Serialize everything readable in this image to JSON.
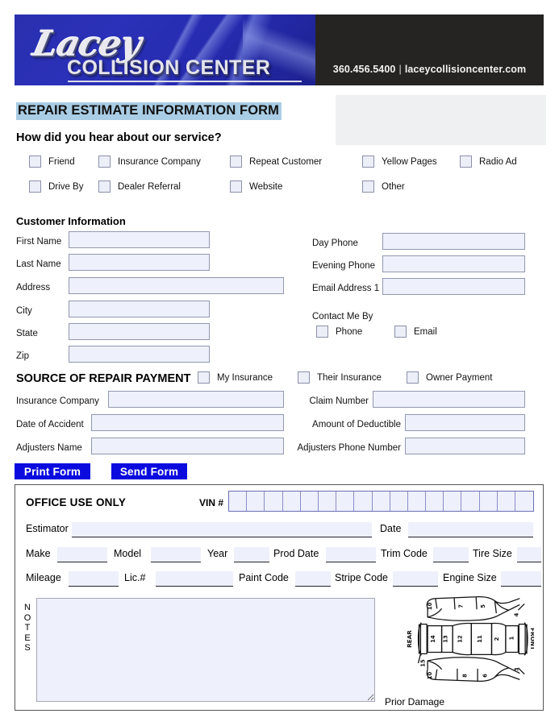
{
  "header": {
    "logo_script": "Lacey",
    "logo_main": "COLLISION CENTER",
    "phone": "360.456.5400",
    "separator": "|",
    "website": "laceycollisioncenter.com"
  },
  "form": {
    "title": "REPAIR ESTIMATE INFORMATION FORM",
    "question": "How did you hear about our service?",
    "referral_options": [
      {
        "label": "Friend"
      },
      {
        "label": "Insurance Company"
      },
      {
        "label": "Repeat Customer"
      },
      {
        "label": "Yellow Pages"
      },
      {
        "label": "Radio Ad"
      },
      {
        "label": "Drive By"
      },
      {
        "label": "Dealer Referral"
      },
      {
        "label": "Website"
      },
      {
        "label": "Other"
      }
    ]
  },
  "customer": {
    "section_title": "Customer Information",
    "left_fields": [
      {
        "label": "First Name",
        "value": ""
      },
      {
        "label": "Last Name",
        "value": ""
      },
      {
        "label": "Address",
        "value": ""
      },
      {
        "label": "City",
        "value": ""
      },
      {
        "label": "State",
        "value": ""
      },
      {
        "label": "Zip",
        "value": ""
      }
    ],
    "right_fields": [
      {
        "label": "Day Phone",
        "value": ""
      },
      {
        "label": "Evening Phone",
        "value": ""
      },
      {
        "label": "Email Address 1",
        "value": ""
      }
    ],
    "contact_me_by": "Contact Me By",
    "contact_options": [
      {
        "label": "Phone"
      },
      {
        "label": "Email"
      }
    ]
  },
  "payment": {
    "section_title": "SOURCE OF REPAIR PAYMENT",
    "options": [
      {
        "label": "My Insurance"
      },
      {
        "label": "Their Insurance"
      },
      {
        "label": "Owner Payment"
      }
    ],
    "left_fields": [
      {
        "label": "Insurance Company",
        "value": ""
      },
      {
        "label": "Date of Accident",
        "value": ""
      },
      {
        "label": "Adjusters Name",
        "value": ""
      }
    ],
    "right_fields": [
      {
        "label": "Claim Number",
        "value": ""
      },
      {
        "label": "Amount of Deductible",
        "value": ""
      },
      {
        "label": "Adjusters Phone Number",
        "value": ""
      }
    ]
  },
  "actions": {
    "print_label": "Print Form",
    "send_label": "Send Form"
  },
  "office": {
    "title": "OFFICE USE ONLY",
    "vin_label": "VIN #",
    "vin_cells": 17,
    "estimator_label": "Estimator",
    "date_label": "Date",
    "vehicle_row1": [
      {
        "label": "Make"
      },
      {
        "label": "Model"
      },
      {
        "label": "Year"
      },
      {
        "label": "Prod Date"
      },
      {
        "label": "Trim Code"
      },
      {
        "label": "Tire Size"
      }
    ],
    "vehicle_row2": [
      {
        "label": "Mileage"
      },
      {
        "label": "Lic.#"
      },
      {
        "label": "Paint Code"
      },
      {
        "label": "Stripe Code"
      },
      {
        "label": "Engine Size"
      }
    ],
    "notes_label": "NOTES",
    "notes_value": "",
    "diagram": {
      "caption": "Prior Damage",
      "rear_label": "REAR",
      "front_label": "FRONT",
      "panel_numbers": [
        "1",
        "2",
        "3",
        "4",
        "5",
        "6",
        "7",
        "8",
        "9",
        "10",
        "11",
        "12",
        "13",
        "14",
        "15"
      ]
    }
  },
  "colors": {
    "logo_blue": "#2a2fae",
    "header_dark": "#262423",
    "title_highlight": "#a9cde5",
    "button_blue": "#0b0bdf",
    "input_fill": "#eef0fb",
    "input_border": "#9198b0",
    "gray_box": "#eef0f2"
  }
}
